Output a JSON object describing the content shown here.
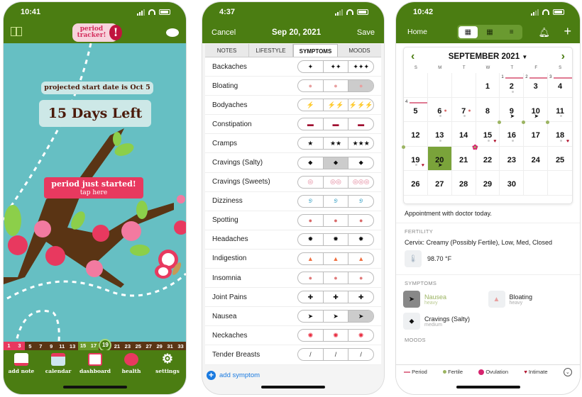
{
  "phone1": {
    "status_time": "10:41",
    "logo_text": "period tracker!",
    "projected_text": "projected start date is Oct 5",
    "days_left": "15 Days Left",
    "period_started_label": "period just started!",
    "tap_here_label": "tap here",
    "cycle_days": [
      "1",
      "3",
      "5",
      "7",
      "9",
      "11",
      "13",
      "15",
      "17",
      "19",
      "21",
      "23",
      "25",
      "27",
      "29",
      "31",
      "33"
    ],
    "current_day": "19",
    "tabs": [
      {
        "label": "add note",
        "icon": "notepad-icon"
      },
      {
        "label": "calendar",
        "icon": "calendar-icon"
      },
      {
        "label": "dashboard",
        "icon": "chart-icon"
      },
      {
        "label": "health",
        "icon": "heart-pulse-icon"
      },
      {
        "label": "settings",
        "icon": "gear-icon"
      }
    ],
    "colors": {
      "header": "#4b7d12",
      "background": "#66bfc3",
      "accent": "#e8395f"
    }
  },
  "phone2": {
    "status_time": "4:37",
    "cancel_label": "Cancel",
    "title": "Sep 20, 2021",
    "save_label": "Save",
    "tabs": [
      "NOTES",
      "LIFESTYLE",
      "SYMPTOMS",
      "MOODS"
    ],
    "active_tab": "SYMPTOMS",
    "symptoms": [
      {
        "name": "Backaches",
        "glyphs": [
          "✦",
          "✦✦",
          "✦✦✦"
        ],
        "selected": null
      },
      {
        "name": "Bloating",
        "glyphs": [
          "●",
          "●",
          "●"
        ],
        "selected": 3
      },
      {
        "name": "Bodyaches",
        "glyphs": [
          "⚡",
          "⚡⚡",
          "⚡⚡⚡"
        ],
        "selected": null
      },
      {
        "name": "Constipation",
        "glyphs": [
          "▬",
          "▬",
          "▬"
        ],
        "selected": null
      },
      {
        "name": "Cramps",
        "glyphs": [
          "★",
          "★★",
          "★★★"
        ],
        "selected": null
      },
      {
        "name": "Cravings (Salty)",
        "glyphs": [
          "⬥",
          "⬥",
          "⬥"
        ],
        "selected": 2
      },
      {
        "name": "Cravings (Sweets)",
        "glyphs": [
          "◎",
          "◎◎",
          "◎◎◎"
        ],
        "selected": null
      },
      {
        "name": "Dizziness",
        "glyphs": [
          "୭",
          "୭",
          "୭"
        ],
        "selected": null
      },
      {
        "name": "Spotting",
        "glyphs": [
          "●",
          "●",
          "●"
        ],
        "selected": null
      },
      {
        "name": "Headaches",
        "glyphs": [
          "✹",
          "✹",
          "✹"
        ],
        "selected": null
      },
      {
        "name": "Indigestion",
        "glyphs": [
          "▲",
          "▲",
          "▲"
        ],
        "selected": null
      },
      {
        "name": "Insomnia",
        "glyphs": [
          "●",
          "●",
          "●"
        ],
        "selected": null
      },
      {
        "name": "Joint Pains",
        "glyphs": [
          "✚",
          "✚",
          "✚"
        ],
        "selected": null
      },
      {
        "name": "Nausea",
        "glyphs": [
          "➤",
          "➤",
          "➤"
        ],
        "selected": 3
      },
      {
        "name": "Neckaches",
        "glyphs": [
          "✺",
          "✺",
          "✺"
        ],
        "selected": null
      },
      {
        "name": "Tender Breasts",
        "glyphs": [
          "/",
          "/",
          "/"
        ],
        "selected": null
      }
    ],
    "add_symptom_label": "add symptom"
  },
  "phone3": {
    "status_time": "10:42",
    "home_label": "Home",
    "month_title": "SEPTEMBER 2021",
    "weekdays": [
      "S",
      "M",
      "T",
      "W",
      "T",
      "F",
      "S"
    ],
    "weeks": [
      [
        "",
        "",
        "",
        "1",
        "2",
        "3",
        "4"
      ],
      [
        "5",
        "6",
        "7",
        "8",
        "9",
        "10",
        "11"
      ],
      [
        "12",
        "13",
        "14",
        "15",
        "16",
        "17",
        "18"
      ],
      [
        "19",
        "20",
        "21",
        "22",
        "23",
        "24",
        "25"
      ],
      [
        "26",
        "27",
        "28",
        "29",
        "30",
        "",
        ""
      ]
    ],
    "selected_day": "20",
    "period_day_labels": {
      "2": "1",
      "3": "2",
      "4": "3",
      "5": "4"
    },
    "note": "Appointment with doctor today.",
    "fertility_heading": "FERTILITY",
    "cervix_text": "Cervix: Creamy (Possibly Fertile), Low, Med, Closed",
    "temperature": "98.70 °F",
    "symptoms_heading": "SYMPTOMS",
    "symptoms": [
      {
        "name": "Nausea",
        "level": "heavy"
      },
      {
        "name": "Bloating",
        "level": "heavy"
      },
      {
        "name": "Cravings (Salty)",
        "level": "medium"
      }
    ],
    "moods_heading": "MOODS",
    "legend": [
      "Period",
      "Fertile",
      "Ovulation",
      "Intimate"
    ],
    "colors": {
      "period": "#e07a92",
      "fertile": "#9bb461",
      "ovulation": "#d6246e",
      "intimate": "#b0122d",
      "selected_day": "#7aa33a"
    }
  }
}
